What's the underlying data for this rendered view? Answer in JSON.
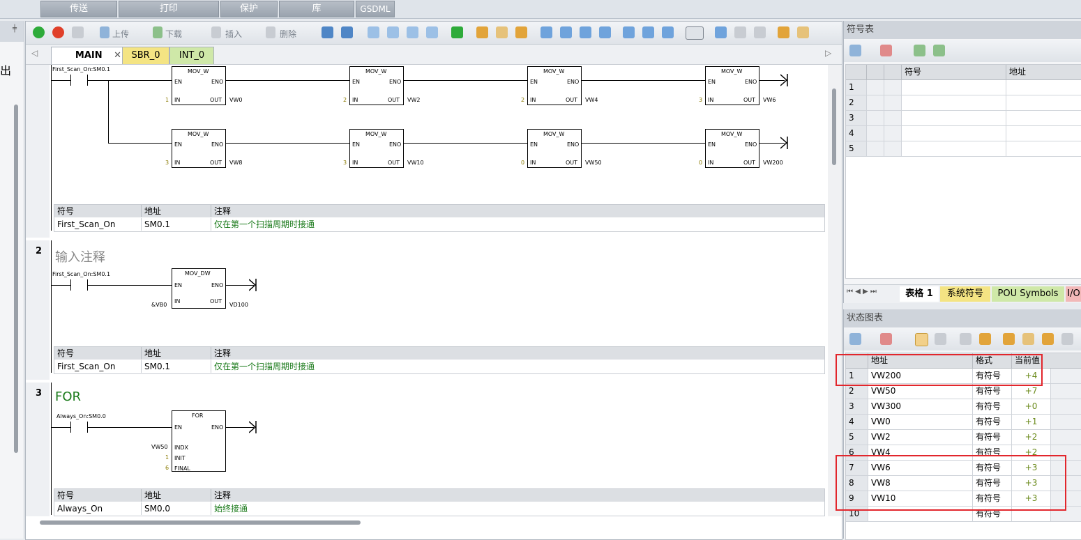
{
  "ribbon": {
    "tabs": [
      "传送",
      "打印",
      "保护",
      "库",
      "GSDML"
    ]
  },
  "left_strip": {
    "char": "出"
  },
  "toolbar": {
    "upload": "上传",
    "download": "下载",
    "insert": "插入",
    "delete": "删除"
  },
  "pou_tabs": [
    {
      "label": "MAIN",
      "close": "✕"
    },
    {
      "label": "SBR_0"
    },
    {
      "label": "INT_0"
    }
  ],
  "networks": {
    "n1": {
      "contact": "First_Scan_On:SM0.1",
      "box_type": "MOV_W",
      "en": "EN",
      "eno": "ENO",
      "in": "IN",
      "out": "OUT",
      "row1": [
        {
          "in": "1",
          "out": "VW0"
        },
        {
          "in": "2",
          "out": "VW2"
        },
        {
          "in": "2",
          "out": "VW4"
        },
        {
          "in": "3",
          "out": "VW6"
        }
      ],
      "row2": [
        {
          "in": "3",
          "out": "VW8"
        },
        {
          "in": "3",
          "out": "VW10"
        },
        {
          "in": "0",
          "out": "VW50"
        },
        {
          "in": "0",
          "out": "VW200"
        }
      ],
      "sym": {
        "h_symbol": "符号",
        "h_addr": "地址",
        "h_comment": "注释",
        "symbol": "First_Scan_On",
        "addr": "SM0.1",
        "comment": "仅在第一个扫描周期时接通"
      }
    },
    "n2": {
      "num": "2",
      "title": "输入注释",
      "contact": "First_Scan_On:SM0.1",
      "box_type": "MOV_DW",
      "en": "EN",
      "eno": "ENO",
      "in": "IN",
      "out": "OUT",
      "in_val": "&VB0",
      "out_val": "VD100",
      "sym": {
        "h_symbol": "符号",
        "h_addr": "地址",
        "h_comment": "注释",
        "symbol": "First_Scan_On",
        "addr": "SM0.1",
        "comment": "仅在第一个扫描周期时接通"
      }
    },
    "n3": {
      "num": "3",
      "title": "FOR",
      "contact": "Always_On:SM0.0",
      "box_type": "FOR",
      "en": "EN",
      "eno": "ENO",
      "indx": "INDX",
      "init": "INIT",
      "final": "FINAL",
      "indx_val": "VW50",
      "init_val": "1",
      "final_val": "6",
      "sym": {
        "h_symbol": "符号",
        "h_addr": "地址",
        "h_comment": "注释",
        "symbol": "Always_On",
        "addr": "SM0.0",
        "comment": "始终接通"
      }
    }
  },
  "symbol_table": {
    "title": "符号表",
    "headers": {
      "symbol": "符号",
      "address": "地址"
    },
    "rows": [
      "1",
      "2",
      "3",
      "4",
      "5"
    ],
    "sheet_tabs": [
      "表格 1",
      "系统符号",
      "POU Symbols",
      "I/O"
    ]
  },
  "status_chart": {
    "title": "状态图表",
    "headers": {
      "address": "地址",
      "format": "格式",
      "value": "当前值"
    },
    "rows": [
      {
        "n": "1",
        "addr": "VW200",
        "fmt": "有符号",
        "val": "+4"
      },
      {
        "n": "2",
        "addr": "VW50",
        "fmt": "有符号",
        "val": "+7"
      },
      {
        "n": "3",
        "addr": "VW300",
        "fmt": "有符号",
        "val": "+0"
      },
      {
        "n": "4",
        "addr": "VW0",
        "fmt": "有符号",
        "val": "+1"
      },
      {
        "n": "5",
        "addr": "VW2",
        "fmt": "有符号",
        "val": "+2"
      },
      {
        "n": "6",
        "addr": "VW4",
        "fmt": "有符号",
        "val": "+2"
      },
      {
        "n": "7",
        "addr": "VW6",
        "fmt": "有符号",
        "val": "+3"
      },
      {
        "n": "8",
        "addr": "VW8",
        "fmt": "有符号",
        "val": "+3"
      },
      {
        "n": "9",
        "addr": "VW10",
        "fmt": "有符号",
        "val": "+3"
      },
      {
        "n": "10",
        "addr": "",
        "fmt": "有符号",
        "val": ""
      }
    ]
  }
}
